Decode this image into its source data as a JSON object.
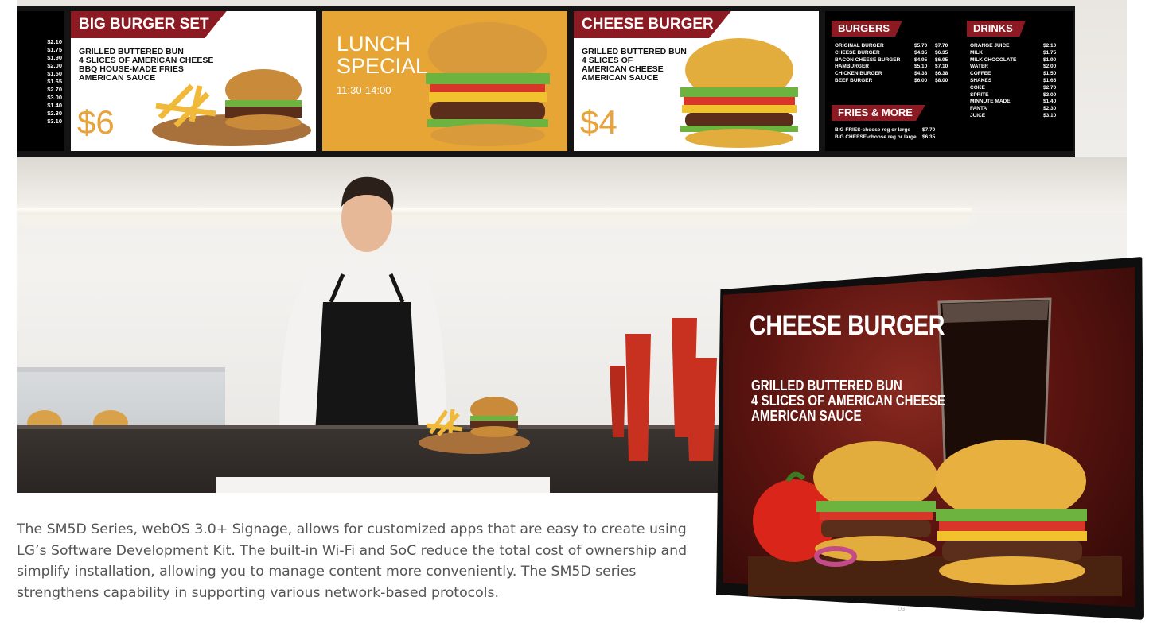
{
  "menu_board": {
    "panel_prices": [
      "$2.10",
      "$1.75",
      "$1.90",
      "$2.00",
      "$1.50",
      "$1.65",
      "$2.70",
      "$3.00",
      "$1.40",
      "$2.30",
      "$3.10"
    ],
    "big_burger_set": {
      "title": "BIG BURGER SET",
      "description": "GRILLED BUTTERED BUN\n4 SLICES OF AMERICAN CHEESE\nBBQ HOUSE-MADE FRIES\nAMERICAN SAUCE",
      "price": "$6"
    },
    "lunch_special": {
      "line1": "LUNCH",
      "line2": "SPECIAL",
      "time": "11:30-14:00"
    },
    "cheese_burger": {
      "title": "CHEESE BURGER",
      "description": "GRILLED BUTTERED BUN\n4 SLICES OF\nAMERICAN CHEESE\nAMERICAN SAUCE",
      "price": "$4"
    },
    "burgers": {
      "heading": "BURGERS",
      "items": [
        {
          "name": "ORIGINAL BURGER",
          "price1": "$5.70",
          "price2": "$7.70"
        },
        {
          "name": "CHEESE BURGER",
          "price1": "$4.35",
          "price2": "$6.35"
        },
        {
          "name": "BACON CHEESE BURGER",
          "price1": "$4.95",
          "price2": "$6.95"
        },
        {
          "name": "HAMBURGER",
          "price1": "$5.10",
          "price2": "$7.10"
        },
        {
          "name": "CHICKEN BURGER",
          "price1": "$4.38",
          "price2": "$6.38"
        },
        {
          "name": "BEEF BURGER",
          "price1": "$6.00",
          "price2": "$8.00"
        }
      ]
    },
    "fries": {
      "heading": "FRIES & MORE",
      "items": [
        {
          "name": "BIG FRIES-choose reg or large",
          "price": "$7.70"
        },
        {
          "name": "BIG CHEESE-choose reg or large",
          "price": "$6.35"
        }
      ]
    },
    "drinks": {
      "heading": "DRINKS",
      "items": [
        {
          "name": "ORANGE JUICE",
          "price": "$2.10"
        },
        {
          "name": "MILK",
          "price": "$1.75"
        },
        {
          "name": "MILK CHOCOLATE",
          "price": "$1.90"
        },
        {
          "name": "WATER",
          "price": "$2.00"
        },
        {
          "name": "COFFEE",
          "price": "$1.50"
        },
        {
          "name": "SHAKES",
          "price": "$1.65"
        },
        {
          "name": "COKE",
          "price": "$2.70"
        },
        {
          "name": "SPRITE",
          "price": "$3.00"
        },
        {
          "name": "MINNUTE MADE",
          "price": "$1.40"
        },
        {
          "name": "FANTA",
          "price": "$2.30"
        },
        {
          "name": "JUICE",
          "price": "$3.10"
        }
      ]
    }
  },
  "tv_display": {
    "title": "CHEESE BURGER",
    "description": "GRILLED BUTTERED BUN\n4 SLICES OF AMERICAN CHEESE\nAMERICAN SAUCE",
    "logo": "LG"
  },
  "caption": "The SM5D Series, webOS 3.0+ Signage, allows for customized apps that are easy to create using LG’s Software Development Kit. The built-in Wi-Fi and SoC reduce the total cost of ownership and simplify installation, allowing you to manage content more conveniently. The SM5D series strengthens capability in supporting various network-based protocols.",
  "colors": {
    "ribbon": "#8c1a22",
    "price": "#e8a33b",
    "lunch_bg": "#e7a536"
  }
}
